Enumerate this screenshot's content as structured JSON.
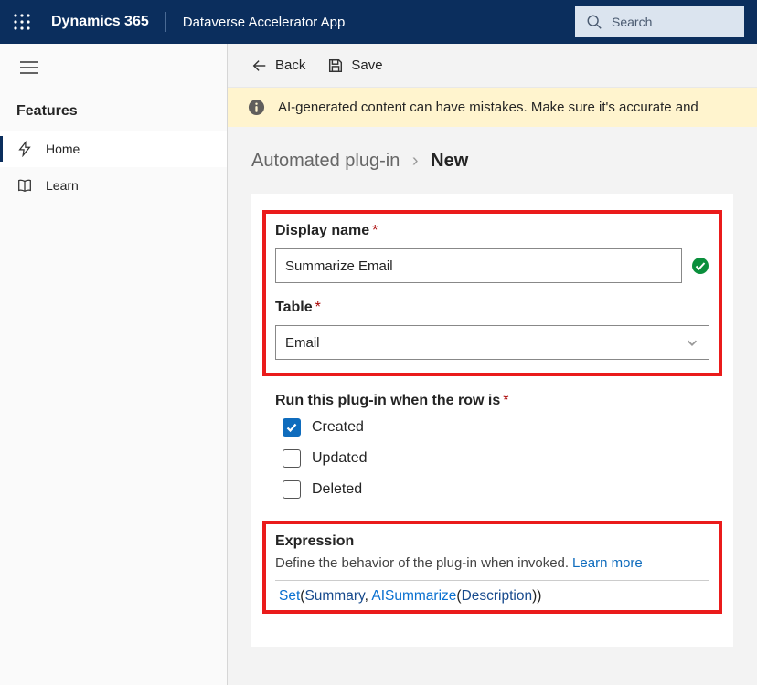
{
  "header": {
    "brand": "Dynamics 365",
    "app_name": "Dataverse Accelerator App",
    "search_placeholder": "Search"
  },
  "sidebar": {
    "heading": "Features",
    "items": [
      {
        "label": "Home",
        "active": true
      },
      {
        "label": "Learn",
        "active": false
      }
    ]
  },
  "commandbar": {
    "back": "Back",
    "save": "Save"
  },
  "warning": "AI-generated content can have mistakes. Make sure it's accurate and",
  "breadcrumb": {
    "parent": "Automated plug-in",
    "current": "New"
  },
  "form": {
    "display_name_label": "Display name",
    "display_name_value": "Summarize Email",
    "table_label": "Table",
    "table_value": "Email",
    "trigger_label": "Run this plug-in when the row is",
    "trigger_options": [
      {
        "label": "Created",
        "checked": true
      },
      {
        "label": "Updated",
        "checked": false
      },
      {
        "label": "Deleted",
        "checked": false
      }
    ],
    "expression_heading": "Expression",
    "expression_sub": "Define the behavior of the plug-in when invoked.",
    "expression_learn": "Learn more",
    "expression": {
      "fn1": "Set",
      "arg1": "Summary",
      "fn2": "AISummarize",
      "arg2": "Description"
    }
  }
}
